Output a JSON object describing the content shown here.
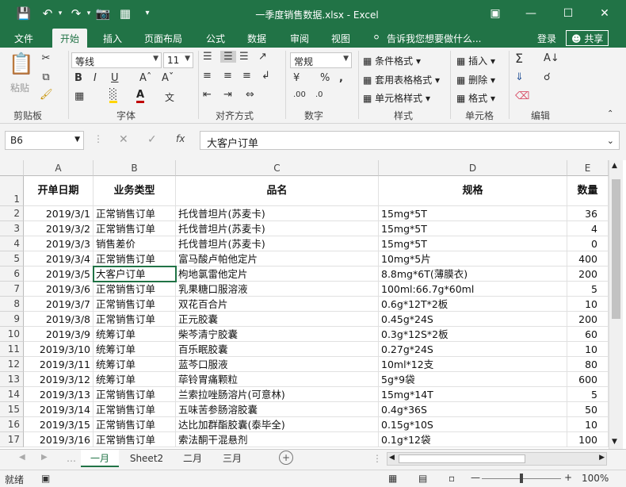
{
  "window": {
    "title": "一季度销售数据.xlsx - Excel",
    "signin": "登录",
    "share": "共享"
  },
  "tabs": [
    "文件",
    "开始",
    "插入",
    "页面布局",
    "公式",
    "数据",
    "审阅",
    "视图"
  ],
  "tellme": "告诉我您想要做什么...",
  "ribbon": {
    "paste": "粘贴",
    "clipboard": "剪贴板",
    "font_name": "等线",
    "font_size": "11",
    "font_group": "字体",
    "align_group": "对齐方式",
    "number_format": "常规",
    "number_group": "数字",
    "cond_format": "条件格式",
    "table_format": "套用表格格式",
    "cell_style": "单元格样式",
    "styles_group": "样式",
    "insert": "插入",
    "delete": "删除",
    "format": "格式",
    "cells_group": "单元格",
    "edit_group": "编辑"
  },
  "formula": {
    "namebox": "B6",
    "fx": "fx",
    "content": "大客户订单"
  },
  "columns": [
    "A",
    "B",
    "C",
    "D",
    "E"
  ],
  "header_row": [
    "开单日期",
    "业务类型",
    "品名",
    "规格",
    "数量"
  ],
  "rows": [
    [
      "2019/3/1",
      "正常销售订单",
      "托伐普坦片(苏麦卡)",
      "15mg*5T",
      "36"
    ],
    [
      "2019/3/2",
      "正常销售订单",
      "托伐普坦片(苏麦卡)",
      "15mg*5T",
      "4"
    ],
    [
      "2019/3/3",
      "销售差价",
      "托伐普坦片(苏麦卡)",
      "15mg*5T",
      "0"
    ],
    [
      "2019/3/4",
      "正常销售订单",
      "富马酸卢帕他定片",
      "10mg*5片",
      "400"
    ],
    [
      "2019/3/5",
      "大客户订单",
      "枸地氯雷他定片",
      "8.8mg*6T(薄膜衣)",
      "200"
    ],
    [
      "2019/3/6",
      "正常销售订单",
      "乳果糖口服溶液",
      "100ml:66.7g*60ml",
      "5"
    ],
    [
      "2019/3/7",
      "正常销售订单",
      "双花百合片",
      "0.6g*12T*2板",
      "10"
    ],
    [
      "2019/3/8",
      "正常销售订单",
      "正元胶囊",
      "0.45g*24S",
      "200"
    ],
    [
      "2019/3/9",
      "统筹订单",
      "柴芩清宁胶囊",
      "0.3g*12S*2板",
      "60"
    ],
    [
      "2019/3/10",
      "统筹订单",
      "百乐眠胶囊",
      "0.27g*24S",
      "10"
    ],
    [
      "2019/3/11",
      "统筹订单",
      "蓝芩口服液",
      "10ml*12支",
      "80"
    ],
    [
      "2019/3/12",
      "统筹订单",
      "荜铃胃痛颗粒",
      "5g*9袋",
      "600"
    ],
    [
      "2019/3/13",
      "正常销售订单",
      "兰索拉唑肠溶片(可意林)",
      "15mg*14T",
      "5"
    ],
    [
      "2019/3/14",
      "正常销售订单",
      "五味苦参肠溶胶囊",
      "0.4g*36S",
      "50"
    ],
    [
      "2019/3/15",
      "正常销售订单",
      "达比加群酯胶囊(泰毕全)",
      "0.15g*10S",
      "10"
    ],
    [
      "2019/3/16",
      "正常销售订单",
      "索法酮干混悬剂",
      "0.1g*12袋",
      "100"
    ]
  ],
  "sheets": [
    "一月",
    "Sheet2",
    "二月",
    "三月"
  ],
  "status": {
    "ready": "就绪",
    "zoom": "100%"
  }
}
